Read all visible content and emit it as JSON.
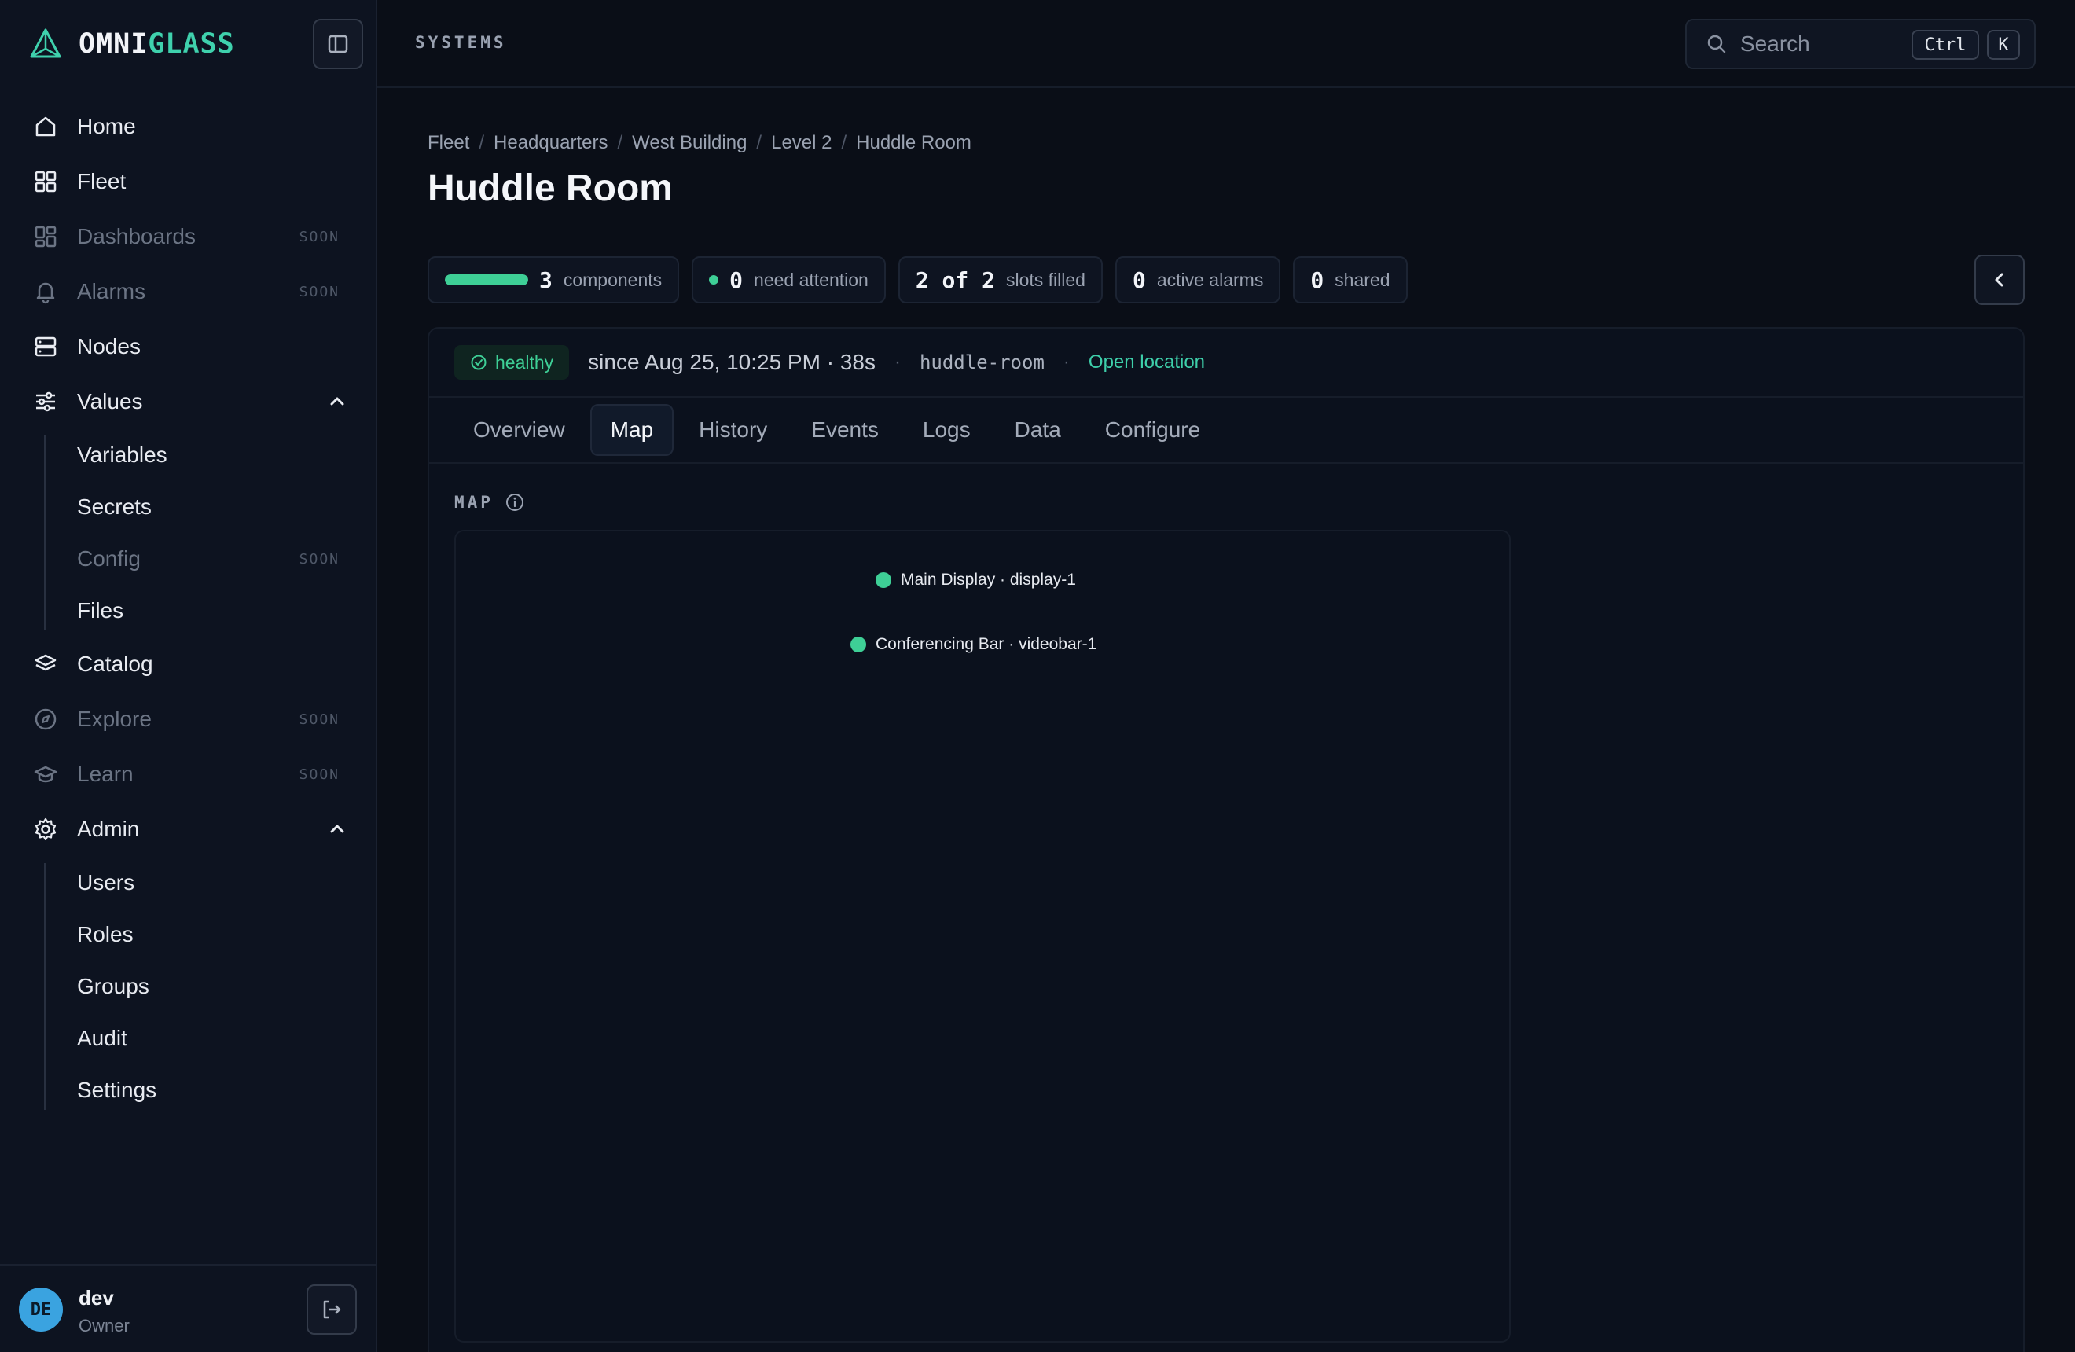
{
  "brand": {
    "name_a": "OMNI",
    "name_b": "GLASS"
  },
  "sidebar": {
    "items": [
      {
        "label": "Home"
      },
      {
        "label": "Fleet"
      },
      {
        "label": "Dashboards",
        "badge": "SOON"
      },
      {
        "label": "Alarms",
        "badge": "SOON"
      },
      {
        "label": "Nodes"
      },
      {
        "label": "Values"
      },
      {
        "label": "Catalog"
      },
      {
        "label": "Explore",
        "badge": "SOON"
      },
      {
        "label": "Learn",
        "badge": "SOON"
      },
      {
        "label": "Admin"
      }
    ],
    "values_sub": [
      {
        "label": "Variables"
      },
      {
        "label": "Secrets"
      },
      {
        "label": "Config",
        "badge": "SOON"
      },
      {
        "label": "Files"
      }
    ],
    "admin_sub": [
      {
        "label": "Users"
      },
      {
        "label": "Roles"
      },
      {
        "label": "Groups"
      },
      {
        "label": "Audit"
      },
      {
        "label": "Settings"
      }
    ]
  },
  "user": {
    "initials": "DE",
    "name": "dev",
    "role": "Owner"
  },
  "topbar": {
    "section": "SYSTEMS",
    "search_placeholder": "Search",
    "kbd_1": "Ctrl",
    "kbd_2": "K"
  },
  "breadcrumb": [
    "Fleet",
    "Headquarters",
    "West Building",
    "Level 2",
    "Huddle Room"
  ],
  "page_title": "Huddle Room",
  "stats": {
    "components": {
      "value": "3",
      "label": "components",
      "fill": 1.0
    },
    "attention": {
      "value": "0",
      "label": "need attention"
    },
    "slots": {
      "value": "2 of 2",
      "label": "slots filled"
    },
    "alarms": {
      "value": "0",
      "label": "active alarms"
    },
    "shared": {
      "value": "0",
      "label": "shared"
    }
  },
  "status": {
    "health": "healthy",
    "since": "since Aug 25, 10:25 PM · 38s",
    "slug": "huddle-room",
    "link": "Open location",
    "sep": "·"
  },
  "tabs": [
    "Overview",
    "Map",
    "History",
    "Events",
    "Logs",
    "Data",
    "Configure"
  ],
  "active_tab": "Map",
  "map": {
    "label": "MAP",
    "nodes": [
      {
        "label": "Main Display · display-1"
      },
      {
        "label": "Conferencing Bar · videobar-1"
      }
    ]
  },
  "colors": {
    "accent": "#3ecfaa",
    "healthy": "#3ecf96",
    "background": "#0a0e17",
    "sidebar": "#0d1320"
  }
}
